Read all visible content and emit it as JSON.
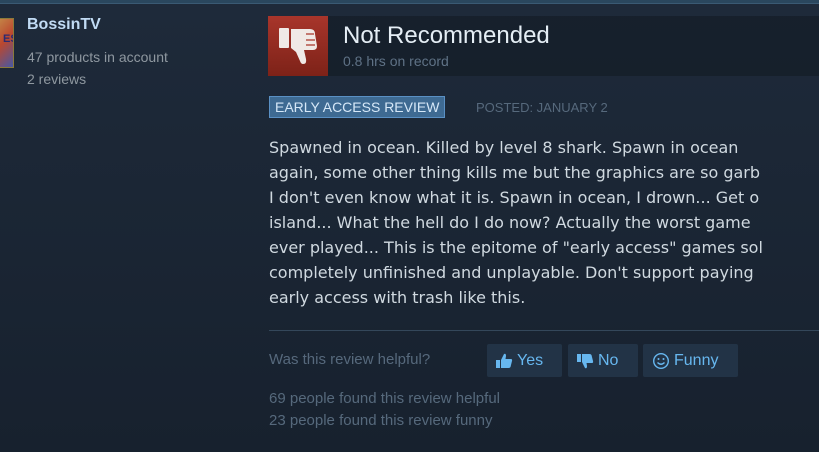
{
  "author": {
    "name": "BossinTV",
    "products": "47 products in account",
    "reviews": "2 reviews",
    "avatar_text": "ES"
  },
  "review": {
    "verdict": "Not Recommended",
    "verdict_icon": "thumbs-down-icon",
    "hours": "0.8 hrs on record",
    "badge": "EARLY ACCESS REVIEW",
    "posted": "POSTED: JANUARY 2",
    "lines": [
      "Spawned in ocean. Killed by level 8 shark. Spawn in ocean",
      "again, some other thing kills me but the graphics are so garb",
      "I don't even know what it is. Spawn in ocean, I drown... Get o",
      "island... What the hell do I do now? Actually the worst game",
      "ever played... This is the epitome of \"early access\" games sol",
      "completely unfinished and unplayable. Don't support paying",
      "early access with trash like this."
    ]
  },
  "feedback": {
    "question": "Was this review helpful?",
    "yes": "Yes",
    "no": "No",
    "funny": "Funny",
    "helpful_count": "69 people found this review helpful",
    "funny_count": "23 people found this review funny"
  },
  "colors": {
    "background": "#1b2838",
    "not_recommended": "#a8352b",
    "link_blue": "#67b7ef",
    "badge_blue": "#3e6a92"
  }
}
